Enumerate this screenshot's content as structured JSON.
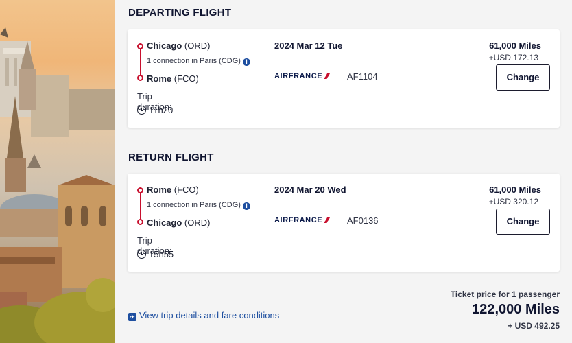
{
  "departing": {
    "heading": "DEPARTING FLIGHT",
    "origin_city": "Chicago",
    "origin_code": "(ORD)",
    "connection": "1 connection in Paris (CDG)",
    "dest_city": "Rome",
    "dest_code": "(FCO)",
    "duration_label": "Trip duration:",
    "duration": "11h20",
    "date": "2024 Mar 12 Tue",
    "airline": "AIRFRANCE",
    "flight_number": "AF1104",
    "miles": "61,000 Miles",
    "usd": "+USD 172.13",
    "change_label": "Change"
  },
  "return": {
    "heading": "RETURN FLIGHT",
    "origin_city": "Rome",
    "origin_code": "(FCO)",
    "connection": "1 connection in Paris (CDG)",
    "dest_city": "Chicago",
    "dest_code": "(ORD)",
    "duration_label": "Trip duration:",
    "duration": "15h55",
    "date": "2024 Mar 20 Wed",
    "airline": "AIRFRANCE",
    "flight_number": "AF0136",
    "miles": "61,000 Miles",
    "usd": "+USD 320.12",
    "change_label": "Change"
  },
  "footer": {
    "view_link": "View trip details and fare conditions",
    "ticket_label": "Ticket price for 1 passenger",
    "total_miles": "122,000 Miles",
    "total_usd": "+ USD 492.25"
  },
  "icons": {
    "info": "info-icon",
    "clock": "clock-icon",
    "plane": "plane-icon"
  },
  "colors": {
    "route_red": "#c8102e",
    "link_blue": "#1e4fa0",
    "text_dark": "#101530"
  }
}
